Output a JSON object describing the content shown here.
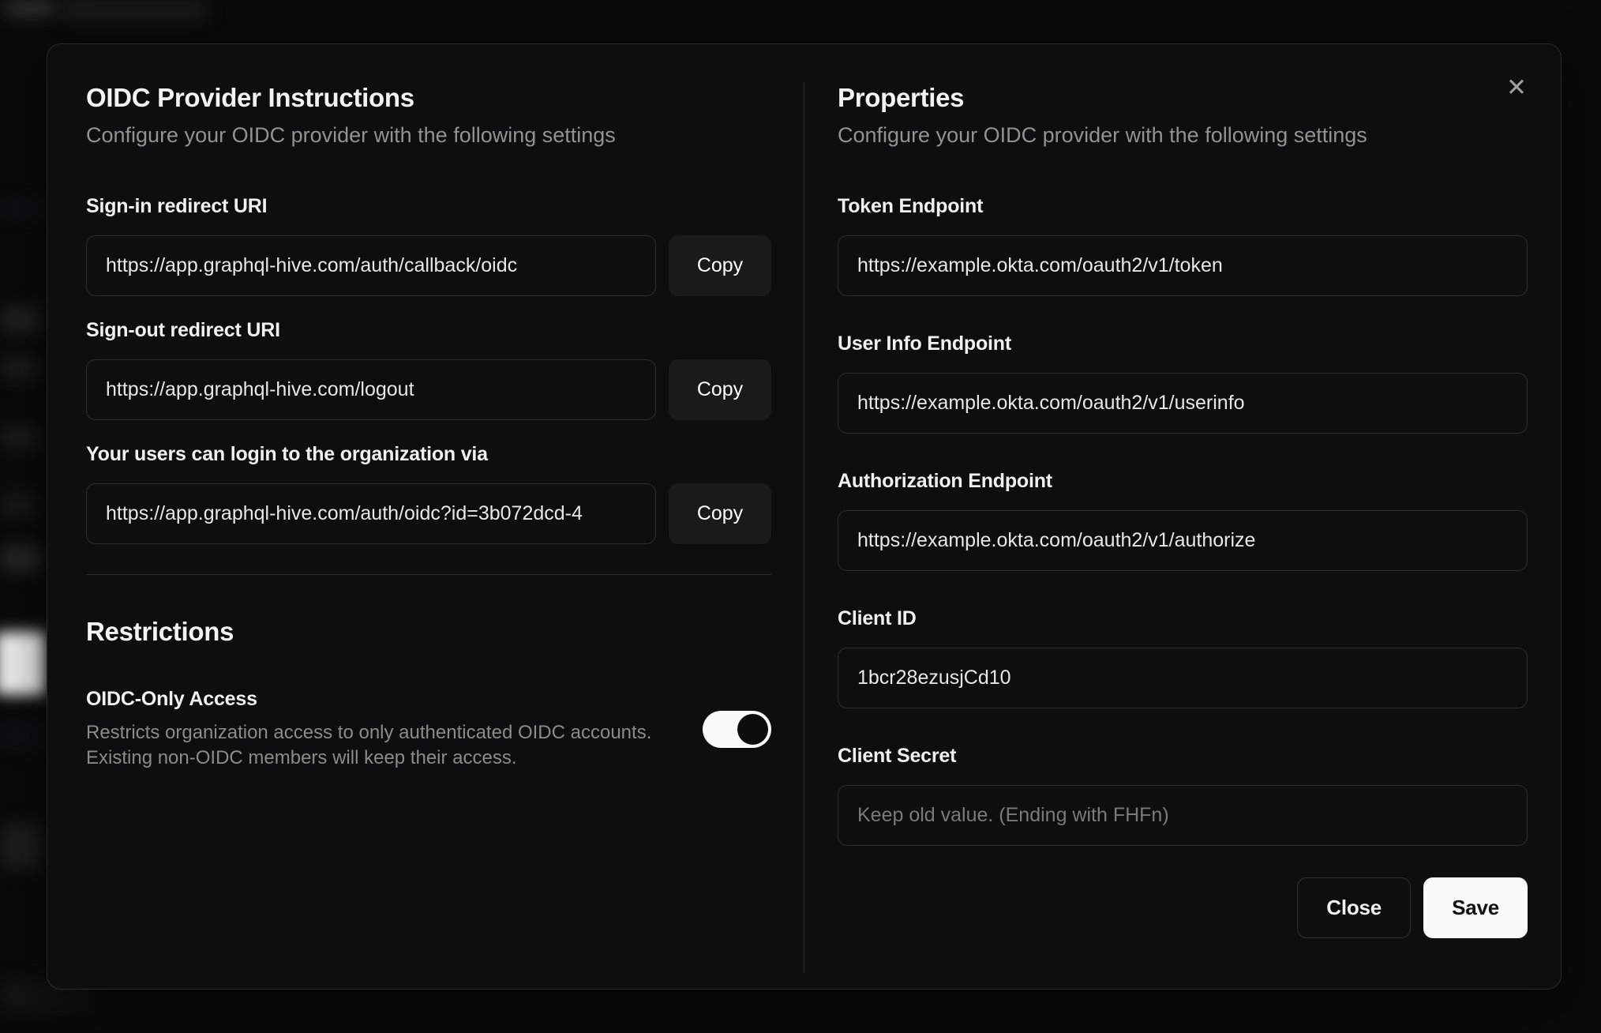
{
  "modal": {
    "close_icon": "✕",
    "left": {
      "title": "OIDC Provider Instructions",
      "subtitle": "Configure your OIDC provider with the following settings",
      "fields": [
        {
          "label": "Sign-in redirect URI",
          "value": "https://app.graphql-hive.com/auth/callback/oidc",
          "copy_label": "Copy"
        },
        {
          "label": "Sign-out redirect URI",
          "value": "https://app.graphql-hive.com/logout",
          "copy_label": "Copy"
        },
        {
          "label": "Your users can login to the organization via",
          "value": "https://app.graphql-hive.com/auth/oidc?id=3b072dcd-4",
          "copy_label": "Copy"
        }
      ],
      "restrictions": {
        "title": "Restrictions",
        "toggle_label": "OIDC-Only Access",
        "toggle_description_line1": "Restricts organization access to only authenticated OIDC accounts.",
        "toggle_description_line2": "Existing non-OIDC members will keep their access.",
        "toggle_state": "on"
      }
    },
    "right": {
      "title": "Properties",
      "subtitle": "Configure your OIDC provider with the following settings",
      "fields": [
        {
          "label": "Token Endpoint",
          "value": "https://example.okta.com/oauth2/v1/token"
        },
        {
          "label": "User Info Endpoint",
          "value": "https://example.okta.com/oauth2/v1/userinfo"
        },
        {
          "label": "Authorization Endpoint",
          "value": "https://example.okta.com/oauth2/v1/authorize"
        },
        {
          "label": "Client ID",
          "value": "1bcr28ezusjCd10"
        },
        {
          "label": "Client Secret",
          "value": "",
          "placeholder": "Keep old value. (Ending with FHFn)"
        }
      ],
      "buttons": {
        "close": "Close",
        "save": "Save"
      }
    },
    "colors": {
      "accent": "#fafafa",
      "modal_bg": "#0e0e11",
      "border": "#2b2b2e"
    }
  }
}
